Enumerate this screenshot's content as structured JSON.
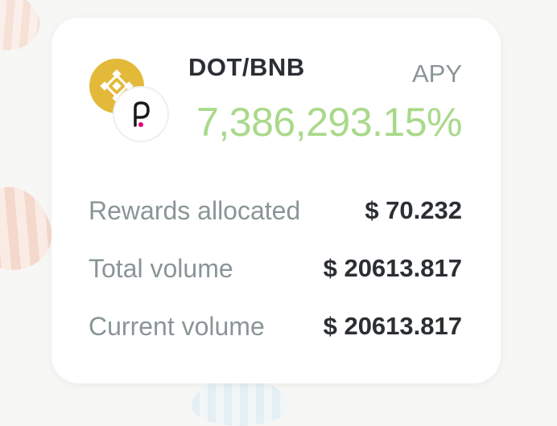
{
  "pool": {
    "pair": "DOT/BNB",
    "apy_label": "APY",
    "apy_value": "7,386,293.15%"
  },
  "tokens": [
    {
      "symbol": "BNB",
      "icon": "bnb-icon",
      "color": "#e3b93a"
    },
    {
      "symbol": "DOT",
      "icon": "polkadot-icon",
      "color": "#e6007a"
    }
  ],
  "stats": [
    {
      "label": "Rewards allocated",
      "value": "$ 70.232"
    },
    {
      "label": "Total volume",
      "value": "$ 20613.817"
    },
    {
      "label": "Current volume",
      "value": "$ 20613.817"
    }
  ],
  "colors": {
    "apy_green": "#a9d98a",
    "muted_text": "#8a9597",
    "dark_text": "#2b2f33",
    "bnb_gold": "#e3b93a",
    "polkadot_pink": "#e6007a"
  }
}
